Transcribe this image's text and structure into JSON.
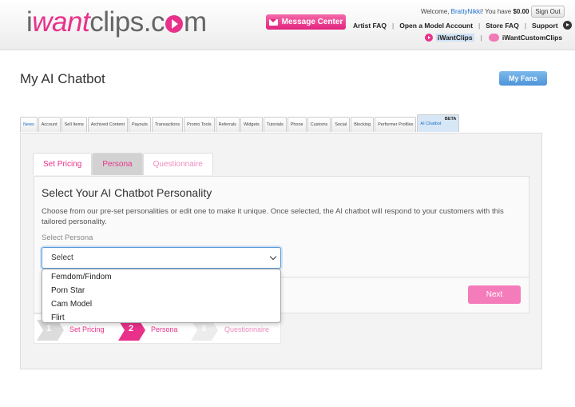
{
  "header": {
    "logo": {
      "part1": "i",
      "part2": "want",
      "part3": "clips.c",
      "part4": "m"
    },
    "message_center": "Message Center",
    "welcome_prefix": "Welcome, ",
    "username": "BrattyNikki",
    "welcome_mid": "! You have ",
    "balance": "$0.00",
    "sign_out": "Sign Out",
    "nav": [
      "Artist FAQ",
      "Open a Model Account",
      "Store FAQ",
      "Support"
    ],
    "sites": [
      "iWantClips",
      "iWantCustomClips"
    ]
  },
  "page": {
    "title": "My AI Chatbot",
    "my_fans": "My Fans"
  },
  "tabs": [
    "News",
    "Account",
    "Sell Items",
    "Archived Content",
    "Payouts",
    "Transactions",
    "Promo Tools",
    "Referrals",
    "Widgets",
    "Tutorials",
    "Phone",
    "Customs",
    "Social",
    "Blocking",
    "Performer Profiles"
  ],
  "active_tab": {
    "label": "AI Chatbot",
    "badge": "BETA"
  },
  "subtabs": [
    "Set Pricing",
    "Persona",
    "Questionnaire"
  ],
  "section": {
    "title": "Select Your AI Chatbot Personality",
    "description": "Choose from our pre-set personalities or edit one to make it unique. Once selected, the AI chatbot will respond to your customers with this tailored personality.",
    "select_label": "Select Persona",
    "select_value": "Select",
    "options": [
      "Femdom/Findom",
      "Porn Star",
      "Cam Model",
      "Flirt"
    ]
  },
  "next_label": "Next",
  "steps": [
    {
      "num": "1",
      "label": "Set Pricing"
    },
    {
      "num": "2",
      "label": "Persona"
    },
    {
      "num": "3",
      "label": "Questionnaire"
    }
  ],
  "colors": {
    "brand_pink": "#e8318a",
    "link_blue": "#1a6fc9",
    "button_blue": "#4d94d9",
    "next_pink": "#f57cbb"
  }
}
